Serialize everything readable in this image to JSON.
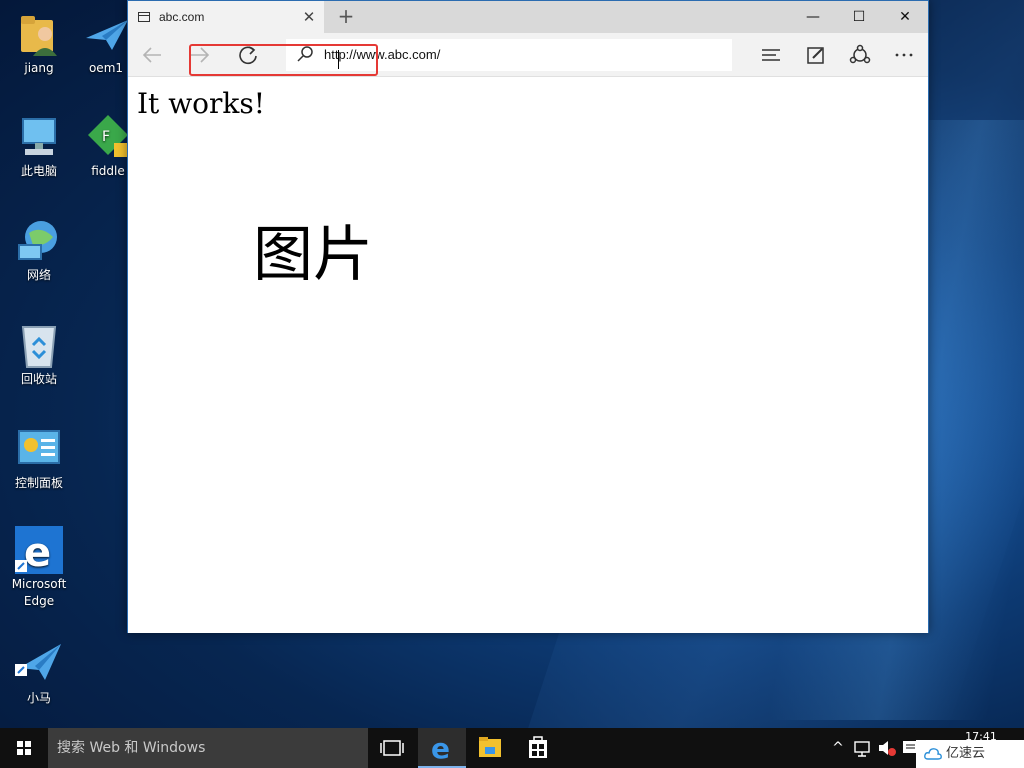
{
  "desktop": {
    "icons": [
      {
        "label": "jiang"
      },
      {
        "label": "oem1"
      },
      {
        "label": "此电脑"
      },
      {
        "label": "fiddle"
      },
      {
        "label": "网络"
      },
      {
        "label": "回收站"
      },
      {
        "label": "控制面板"
      },
      {
        "label": "Microsoft Edge"
      },
      {
        "label": "小马"
      }
    ]
  },
  "browser": {
    "tab_title": "abc.com",
    "tab_close": "✕",
    "new_tab": "+",
    "minimize": "—",
    "maximize": "☐",
    "close": "✕",
    "address": "http://www.abc.com/",
    "page_heading": "It works!",
    "page_image_label": "图片"
  },
  "taskbar": {
    "search_placeholder": "搜索 Web 和 Windows",
    "clock_time": "17:41",
    "tray_up": "^",
    "watermark": "亿速云"
  },
  "colors": {
    "highlight_box": "#e53935",
    "taskbar_bg": "#101010",
    "search_bg": "#3b3b3b",
    "edge_blue": "#1e74d2"
  }
}
